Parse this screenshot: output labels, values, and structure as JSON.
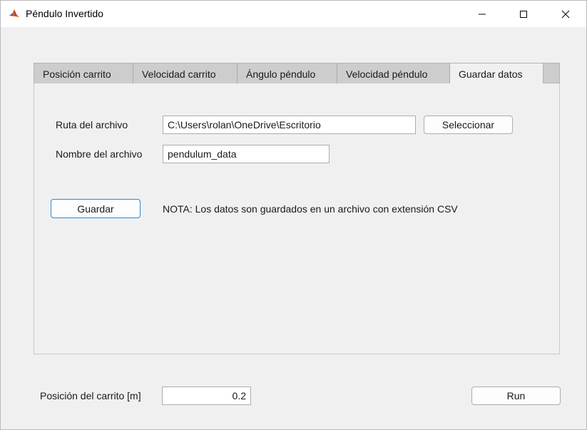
{
  "window": {
    "title": "Péndulo Invertido",
    "controls": {
      "minimize": "minimize-icon",
      "maximize": "maximize-icon",
      "close": "close-icon"
    }
  },
  "tabs": [
    {
      "label": "Posición carrito",
      "active": false
    },
    {
      "label": "Velocidad carrito",
      "active": false
    },
    {
      "label": "Ángulo péndulo",
      "active": false
    },
    {
      "label": "Velocidad péndulo",
      "active": false
    },
    {
      "label": "Guardar datos",
      "active": true
    }
  ],
  "save_panel": {
    "path_label": "Ruta del archivo",
    "path_value": "C:\\Users\\rolan\\OneDrive\\Escritorio",
    "select_button": "Seleccionar",
    "filename_label": "Nombre del archivo",
    "filename_value": "pendulum_data",
    "save_button": "Guardar",
    "note": "NOTA: Los datos son guardados en un archivo con extensión CSV"
  },
  "footer": {
    "position_label": "Posición del carrito [m]",
    "position_value": "0.2",
    "run_button": "Run"
  },
  "colors": {
    "focus_border": "#2b8ad9",
    "tab_inactive": "#cdcdcd",
    "background": "#f0f0f0"
  }
}
